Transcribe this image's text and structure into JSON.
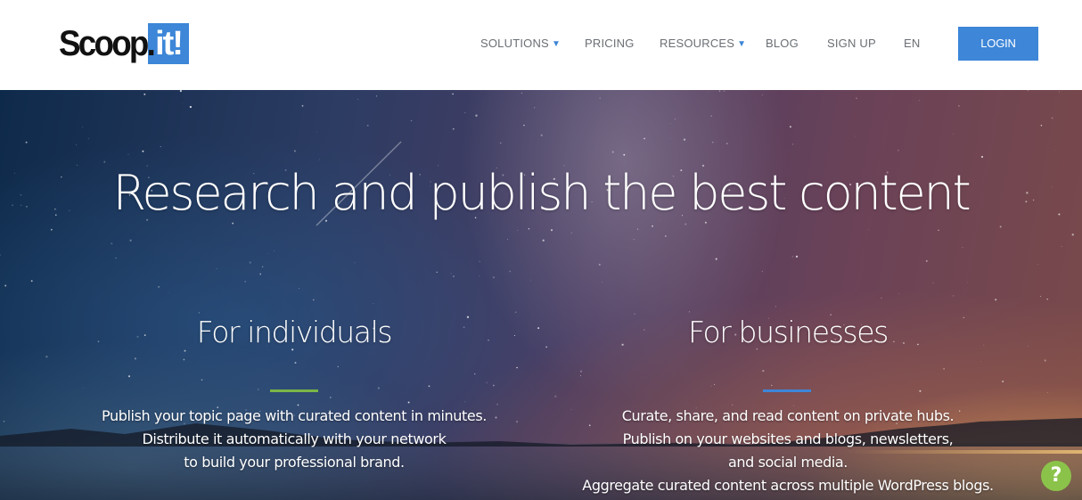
{
  "header": {
    "logo": {
      "text": "Scoop.",
      "box_text": "it!"
    },
    "nav": [
      {
        "label": "SOLUTIONS",
        "has_dropdown": true
      },
      {
        "label": "PRICING",
        "has_dropdown": false
      },
      {
        "label": "RESOURCES",
        "has_dropdown": true
      },
      {
        "label": "BLOG",
        "has_dropdown": false
      },
      {
        "label": "SIGN UP",
        "has_dropdown": false
      },
      {
        "label": "EN",
        "has_dropdown": false
      }
    ],
    "dropdown_caret": "▼",
    "login_label": "LOGIN"
  },
  "hero": {
    "title": "Research and publish the best content",
    "individuals": {
      "title": "For individuals",
      "accent_color": "#7ab648",
      "lines": [
        "Publish your topic page with curated content in minutes.",
        "Distribute it automatically with your network",
        "to build your professional brand."
      ]
    },
    "businesses": {
      "title": "For businesses",
      "accent_color": "#3d86d8",
      "lines": [
        "Curate, share, and read content on private hubs.",
        "Publish on your websites and blogs, newsletters,",
        "and social media.",
        "Aggregate curated content across multiple WordPress blogs."
      ]
    },
    "help_label": "?"
  },
  "colors": {
    "brand_blue": "#3d86d8",
    "nav_text": "#6a6f74",
    "help_green": "#8bc34a"
  }
}
